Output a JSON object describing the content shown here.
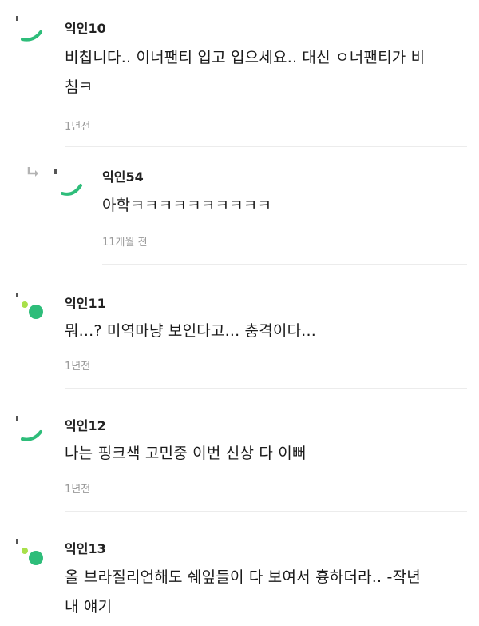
{
  "comments": [
    {
      "author": "익인10",
      "body_lines": [
        "비칩니다.. 이너팬티 입고 입으세요.. 대신 ㅇ너팬티가 비",
        "침ㅋ"
      ],
      "time": "1년전",
      "avatar_icon": "arc-avatar-icon"
    },
    {
      "author": "익인54",
      "body_lines": [
        "아학ㅋㅋㅋㅋㅋㅋㅋㅋㅋㅋ"
      ],
      "time": "11개월 전",
      "avatar_icon": "arc-avatar-icon",
      "reply_icon": "reply-arrow-icon"
    },
    {
      "author": "익인11",
      "body_lines": [
        "뭐...? 미역마냥 보인다고... 충격이다..."
      ],
      "time": "1년전",
      "avatar_icon": "dots-avatar-icon"
    },
    {
      "author": "익인12",
      "body_lines": [
        "나는 핑크색 고민중 이번 신상 다 이뻐"
      ],
      "time": "1년전",
      "avatar_icon": "arc-avatar-icon"
    },
    {
      "author": "익인13",
      "body_lines": [
        "올 브라질리언해도 쉐잎들이 다 보여서 흉하더라.. -작년",
        "내 얘기"
      ],
      "time": "",
      "avatar_icon": "dots-avatar-icon"
    }
  ],
  "colors": {
    "accent": "#2ebd7a",
    "accent_light": "#a8e04a",
    "muted": "#9a9a9a",
    "divider": "#ececec"
  }
}
